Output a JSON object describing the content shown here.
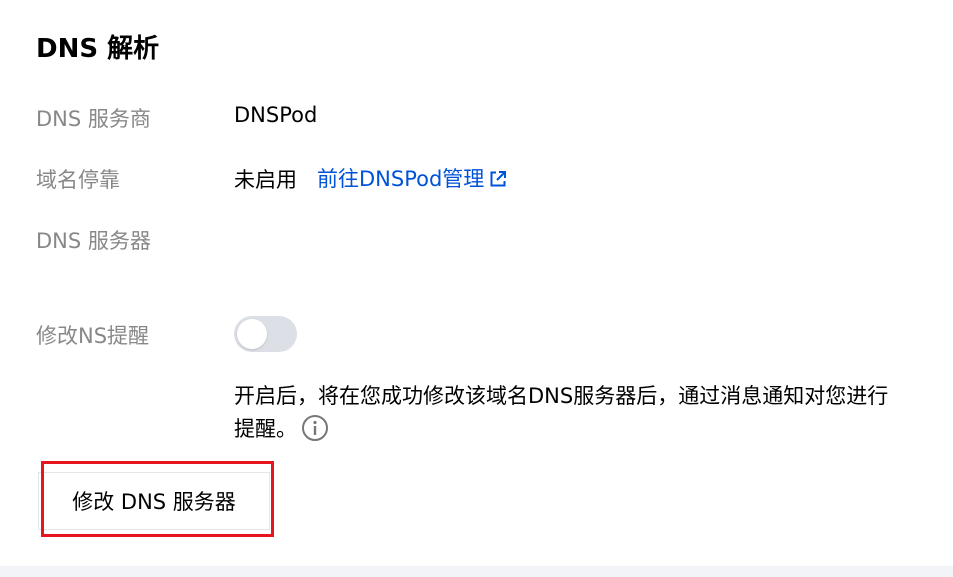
{
  "section": {
    "title": "DNS 解析"
  },
  "rows": {
    "provider": {
      "label": "DNS 服务商",
      "value": "DNSPod"
    },
    "parking": {
      "label": "域名停靠",
      "value": "未启用",
      "link_text": "前往DNSPod管理",
      "link_icon": "external-link-icon"
    },
    "servers": {
      "label": "DNS 服务器",
      "value": ""
    },
    "ns_reminder": {
      "label": "修改NS提醒",
      "toggle_on": false,
      "description_line1": "开启后，将在您成功修改该域名DNS服务器后，通过消息通知对您进行",
      "description_line2": "提醒。",
      "info_icon": "info-icon"
    }
  },
  "actions": {
    "modify_dns_button": "修改 DNS 服务器"
  },
  "colors": {
    "label": "#888888",
    "link": "#0052d9",
    "toggle_off": "#dcdfe5",
    "highlight": "#e8141e"
  }
}
